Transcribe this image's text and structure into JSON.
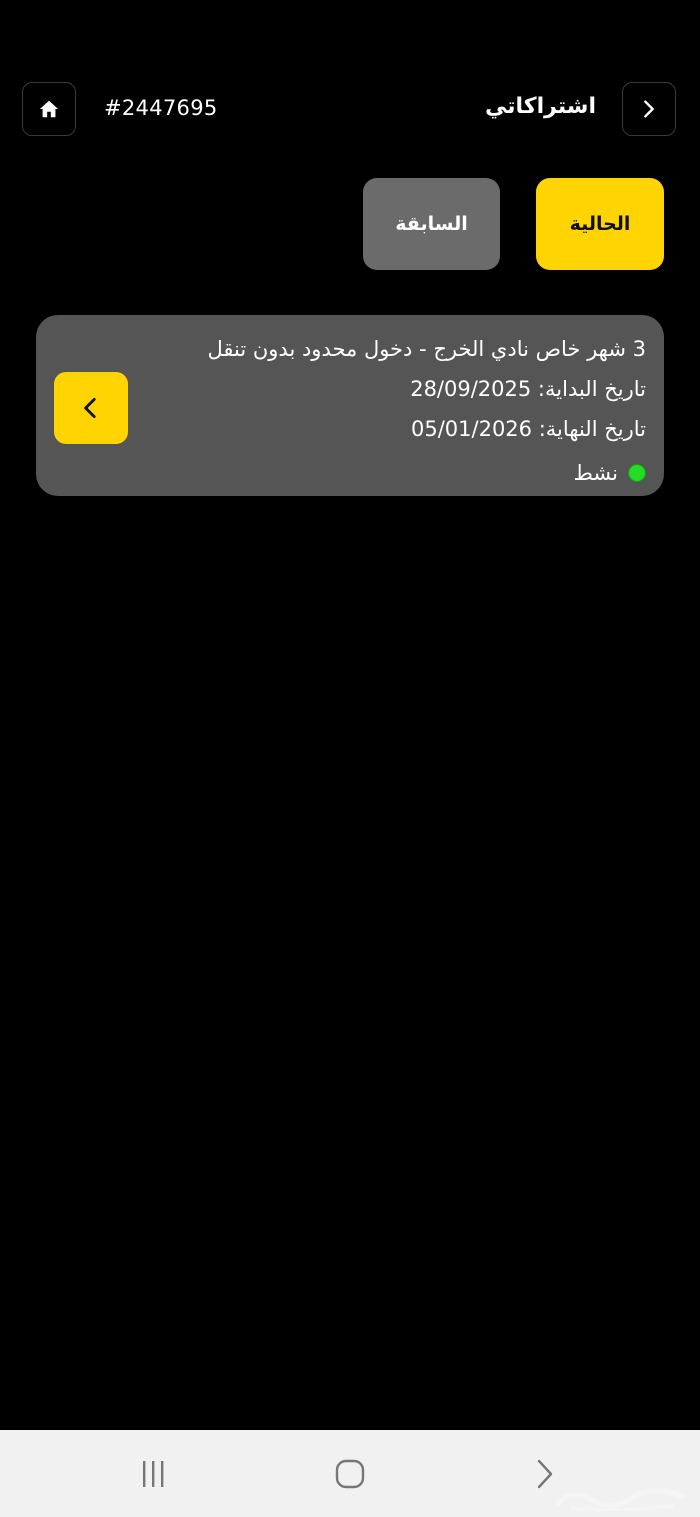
{
  "header": {
    "title": "اشتراكاتي",
    "order_number": "#2447695",
    "home_icon": "home-icon",
    "back_icon": "chevron-right-icon"
  },
  "tabs": [
    {
      "label": "الحالية",
      "active": true
    },
    {
      "label": "السابقة",
      "active": false
    }
  ],
  "subscriptions": [
    {
      "name": "3 شهر خاص نادي الخرج - دخول محدود بدون تنقل",
      "start": "تاريخ البداية: 28/09/2025",
      "end": "تاريخ النهاية: 05/01/2026",
      "status": "نشط",
      "status_color": "#22dd22",
      "action_icon": "chevron-left-icon"
    }
  ],
  "colors": {
    "accent": "#FFD400",
    "background": "#000000",
    "card": "#555555",
    "inactive_tab": "#6b6b6b"
  }
}
